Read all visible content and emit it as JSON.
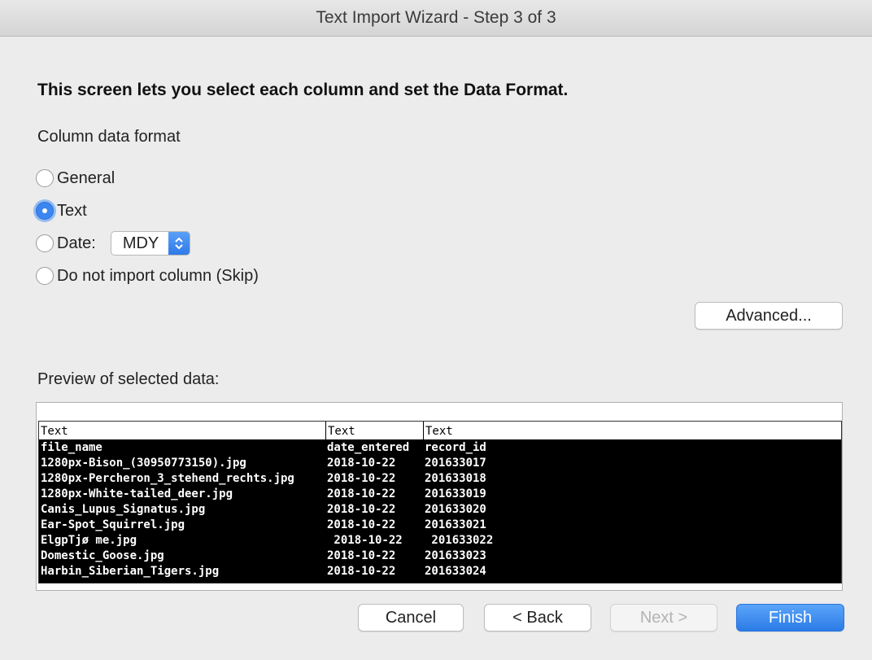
{
  "window": {
    "title": "Text Import Wizard - Step 3 of 3"
  },
  "instruction": "This screen lets you select each column and set the Data Format.",
  "column_format": {
    "label": "Column data format",
    "options": [
      {
        "label": "General",
        "checked": false
      },
      {
        "label": "Text",
        "checked": true
      },
      {
        "label": "Date:",
        "checked": false
      },
      {
        "label": "Do not import column (Skip)",
        "checked": false
      }
    ],
    "date_format": "MDY"
  },
  "advanced_label": "Advanced...",
  "preview": {
    "label": "Preview of selected data:",
    "column_types": [
      "Text",
      "Text",
      "Text"
    ],
    "rows": [
      [
        "file_name",
        "date_entered",
        "record_id"
      ],
      [
        "1280px-Bison_(30950773150).jpg",
        "2018-10-22",
        "201633017"
      ],
      [
        "1280px-Percheron_3_stehend_rechts.jpg",
        "2018-10-22",
        "201633018"
      ],
      [
        "1280px-White-tailed_deer.jpg",
        "2018-10-22",
        "201633019"
      ],
      [
        "Canis_Lupus_Signatus.jpg",
        "2018-10-22",
        "201633020"
      ],
      [
        "Ear-Spot_Squirrel.jpg",
        "2018-10-22",
        "201633021"
      ],
      [
        "ElgpTjø me.jpg",
        " 2018-10-22",
        " 201633022"
      ],
      [
        "Domestic_Goose.jpg",
        "2018-10-22",
        "201633023"
      ],
      [
        "Harbin_Siberian_Tigers.jpg",
        "2018-10-22",
        "201633024"
      ]
    ]
  },
  "buttons": {
    "cancel": "Cancel",
    "back": "< Back",
    "next": "Next >",
    "finish": "Finish"
  },
  "colors": {
    "accent": "#2b7be6",
    "window_bg": "#ececec"
  }
}
